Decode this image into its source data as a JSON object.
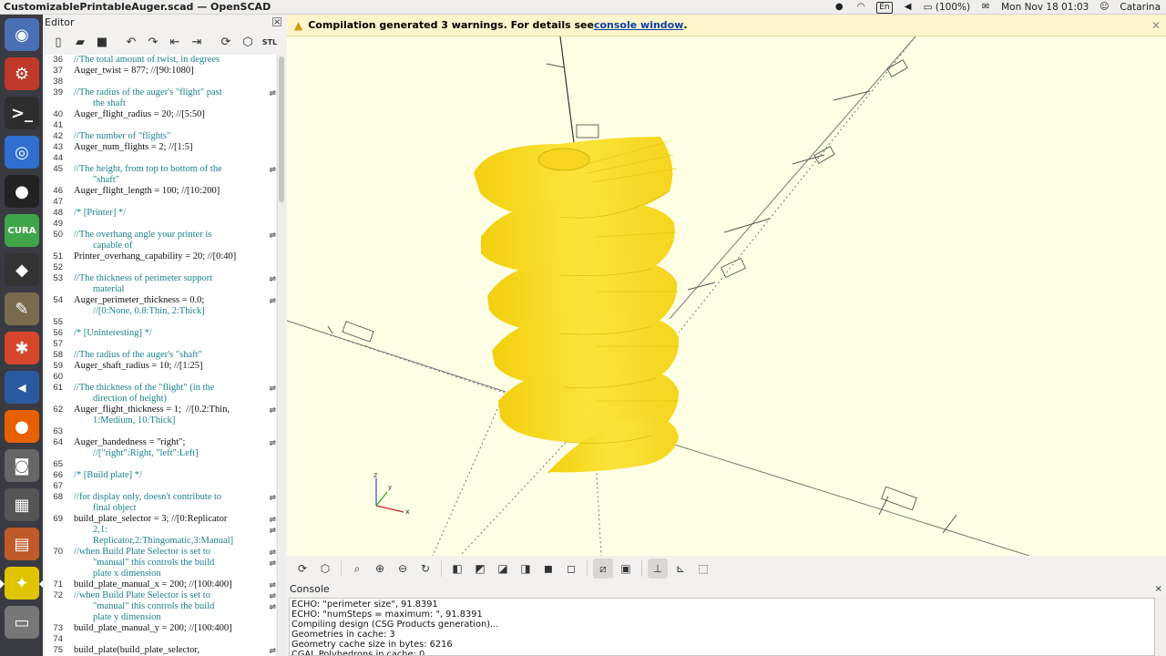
{
  "topbar": {
    "window_title": "CustomizablePrintableAuger.scad — OpenSCAD",
    "battery": "(100%)",
    "clock": "Mon Nov 18 01:03",
    "user": "Catarina",
    "lang": "En"
  },
  "launcher": {
    "items": [
      {
        "name": "ubuntu-dash-icon",
        "bg": "#4a6fb4",
        "glyph": "◉"
      },
      {
        "name": "system-settings-icon",
        "bg": "#c0392b",
        "glyph": "⚙"
      },
      {
        "name": "terminal-icon",
        "bg": "#2e2e2e",
        "glyph": ">_"
      },
      {
        "name": "chromium-icon",
        "bg": "#2f6fd0",
        "glyph": "◎"
      },
      {
        "name": "obs-icon",
        "bg": "#222",
        "glyph": "●"
      },
      {
        "name": "cura-icon",
        "bg": "#3fa44a",
        "glyph": "CURA"
      },
      {
        "name": "inkscape-icon",
        "bg": "#333",
        "glyph": "◆"
      },
      {
        "name": "gimp-icon",
        "bg": "#7a6b4f",
        "glyph": "✎"
      },
      {
        "name": "settings-gear-icon",
        "bg": "#d6462b",
        "glyph": "✱"
      },
      {
        "name": "vscode-icon",
        "bg": "#2c5aa0",
        "glyph": "◂"
      },
      {
        "name": "firefox-icon",
        "bg": "#e66000",
        "glyph": "●"
      },
      {
        "name": "camera-icon",
        "bg": "#666",
        "glyph": "◙"
      },
      {
        "name": "calculator-icon",
        "bg": "#555",
        "glyph": "▦"
      },
      {
        "name": "files-drawer-icon",
        "bg": "#c05a2a",
        "glyph": "▤"
      },
      {
        "name": "openscad-icon",
        "bg": "#e0c400",
        "glyph": "✦"
      },
      {
        "name": "disk-drive-icon",
        "bg": "#777",
        "glyph": "▭"
      }
    ]
  },
  "editor": {
    "title": "Editor",
    "toolbar": [
      "new-file",
      "open-file",
      "save-file",
      "undo",
      "redo",
      "unindent",
      "indent",
      "preview",
      "render",
      "export-stl"
    ],
    "lines": [
      {
        "n": "36",
        "t": "//The total amount of twist, in degrees",
        "c": true
      },
      {
        "n": "37",
        "t": "Auger_twist = 877; //[90:1080]",
        "c": false
      },
      {
        "n": "38",
        "t": "",
        "c": false
      },
      {
        "n": "39",
        "t": "//The radius of the auger's \"flight\" past",
        "c": true,
        "f": true
      },
      {
        "n": "",
        "t": "        the shaft",
        "c": true
      },
      {
        "n": "40",
        "t": "Auger_flight_radius = 20; //[5:50]",
        "c": false
      },
      {
        "n": "41",
        "t": "",
        "c": false
      },
      {
        "n": "42",
        "t": "//The number of \"flights\"",
        "c": true
      },
      {
        "n": "43",
        "t": "Auger_num_flights = 2; //[1:5]",
        "c": false
      },
      {
        "n": "44",
        "t": "",
        "c": false
      },
      {
        "n": "45",
        "t": "//The height, from top to bottom of the",
        "c": true,
        "f": true
      },
      {
        "n": "",
        "t": "        \"shaft\"",
        "c": true
      },
      {
        "n": "46",
        "t": "Auger_flight_length = 100; //[10:200]",
        "c": false
      },
      {
        "n": "47",
        "t": "",
        "c": false
      },
      {
        "n": "48",
        "t": "/* [Printer] */",
        "c": true
      },
      {
        "n": "49",
        "t": "",
        "c": false
      },
      {
        "n": "50",
        "t": "//The overhang angle your printer is",
        "c": true,
        "f": true
      },
      {
        "n": "",
        "t": "        capable of",
        "c": true
      },
      {
        "n": "51",
        "t": "Printer_overhang_capability = 20; //[0:40]",
        "c": false
      },
      {
        "n": "52",
        "t": "",
        "c": false
      },
      {
        "n": "53",
        "t": "//The thickness of perimeter support",
        "c": true,
        "f": true
      },
      {
        "n": "",
        "t": "        material",
        "c": true
      },
      {
        "n": "54",
        "t": "Auger_perimeter_thickness = 0.0;",
        "c": false,
        "f": true
      },
      {
        "n": "",
        "t": "        //[0:None, 0.8:Thin, 2:Thick]",
        "c": true
      },
      {
        "n": "55",
        "t": "",
        "c": false
      },
      {
        "n": "56",
        "t": "/* [Uninteresting] */",
        "c": true
      },
      {
        "n": "57",
        "t": "",
        "c": false
      },
      {
        "n": "58",
        "t": "//The radius of the auger's \"shaft\"",
        "c": true
      },
      {
        "n": "59",
        "t": "Auger_shaft_radius = 10; //[1:25]",
        "c": false
      },
      {
        "n": "60",
        "t": "",
        "c": false
      },
      {
        "n": "61",
        "t": "//The thickness of the \"flight\" (in the",
        "c": true,
        "f": true
      },
      {
        "n": "",
        "t": "        direction of height)",
        "c": true
      },
      {
        "n": "62",
        "t": "Auger_flight_thickness = 1;  //[0.2:Thin,",
        "c": false,
        "f": true
      },
      {
        "n": "",
        "t": "        1:Medium, 10:Thick]",
        "c": true
      },
      {
        "n": "63",
        "t": "",
        "c": false
      },
      {
        "n": "64",
        "t": "Auger_handedness = \"right\";",
        "c": false,
        "f": true
      },
      {
        "n": "",
        "t": "        //[\"right\":Right, \"left\":Left]",
        "c": true
      },
      {
        "n": "65",
        "t": "",
        "c": false
      },
      {
        "n": "66",
        "t": "/* [Build plate] */",
        "c": true
      },
      {
        "n": "67",
        "t": "",
        "c": false
      },
      {
        "n": "68",
        "t": "//for display only, doesn't contribute to",
        "c": true,
        "f": true
      },
      {
        "n": "",
        "t": "        final object",
        "c": true
      },
      {
        "n": "69",
        "t": "build_plate_selector = 3; //[0:Replicator",
        "c": false,
        "f": true
      },
      {
        "n": "",
        "t": "        2,1:",
        "c": true,
        "f": true
      },
      {
        "n": "",
        "t": "        Replicator,2:Thingomatic,3:Manual]",
        "c": true
      },
      {
        "n": "70",
        "t": "//when Build Plate Selector is set to",
        "c": true,
        "f": true
      },
      {
        "n": "",
        "t": "        \"manual\" this controls the build",
        "c": true,
        "f": true
      },
      {
        "n": "",
        "t": "        plate x dimension",
        "c": true
      },
      {
        "n": "71",
        "t": "build_plate_manual_x = 200; //[100:400]",
        "c": false,
        "f": true
      },
      {
        "n": "72",
        "t": "//when Build Plate Selector is set to",
        "c": true,
        "f": true
      },
      {
        "n": "",
        "t": "        \"manual\" this controls the build",
        "c": true,
        "f": true
      },
      {
        "n": "",
        "t": "        plate y dimension",
        "c": true
      },
      {
        "n": "73",
        "t": "build_plate_manual_y = 200; //[100:400]",
        "c": false
      },
      {
        "n": "74",
        "t": "",
        "c": false
      },
      {
        "n": "75",
        "t": "build_plate(build_plate_selector,",
        "c": false,
        "f": true
      }
    ]
  },
  "warning": {
    "text": "Compilation generated 3 warnings. For details see ",
    "link": "console window",
    "tail": "."
  },
  "view_toolbar": [
    "preview",
    "render",
    "view-all",
    "zoom-in",
    "zoom-out",
    "reset-view",
    "view-right",
    "view-top",
    "view-bottom",
    "view-left",
    "view-front",
    "view-back",
    "perspective",
    "orthogonal",
    "show-axes",
    "show-scale-markers",
    "show-edges"
  ],
  "console": {
    "title": "Console",
    "lines": [
      "ECHO: \"perimeter size\", 91.8391",
      "ECHO: \"numSteps = maximum: \", 91.8391",
      "Compiling design (CSG Products generation)...",
      "Geometries in cache: 3",
      "Geometry cache size in bytes: 6216",
      "CGAL Polyhedrons in cache: 0"
    ]
  },
  "axes_indicator": {
    "z": "z",
    "x": "x",
    "y": "y"
  },
  "colors": {
    "model": "#f5d51f",
    "model_shadow": "#c9a800",
    "viewport_bg": "#ffffe5"
  }
}
